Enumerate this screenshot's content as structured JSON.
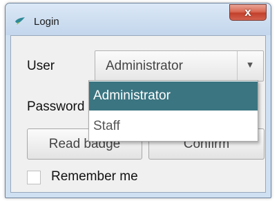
{
  "window": {
    "title": "Login",
    "icon": "app-bird-icon",
    "close_label": "x"
  },
  "form": {
    "user_label": "User",
    "user_value": "Administrator",
    "user_dropdown_icon": "triangle-down",
    "password_label": "Password",
    "read_badge_label": "Read badge",
    "confirm_label": "Confirm",
    "remember_label": "Remember me",
    "remember_checked": false
  },
  "dropdown": {
    "options": [
      "Administrator",
      "Staff"
    ],
    "selected_index": 0
  },
  "colors": {
    "title_bar": "#cfe0f2",
    "close_button": "#c84630",
    "selection": "#3b7581",
    "client_background": "#f0f0f0"
  }
}
